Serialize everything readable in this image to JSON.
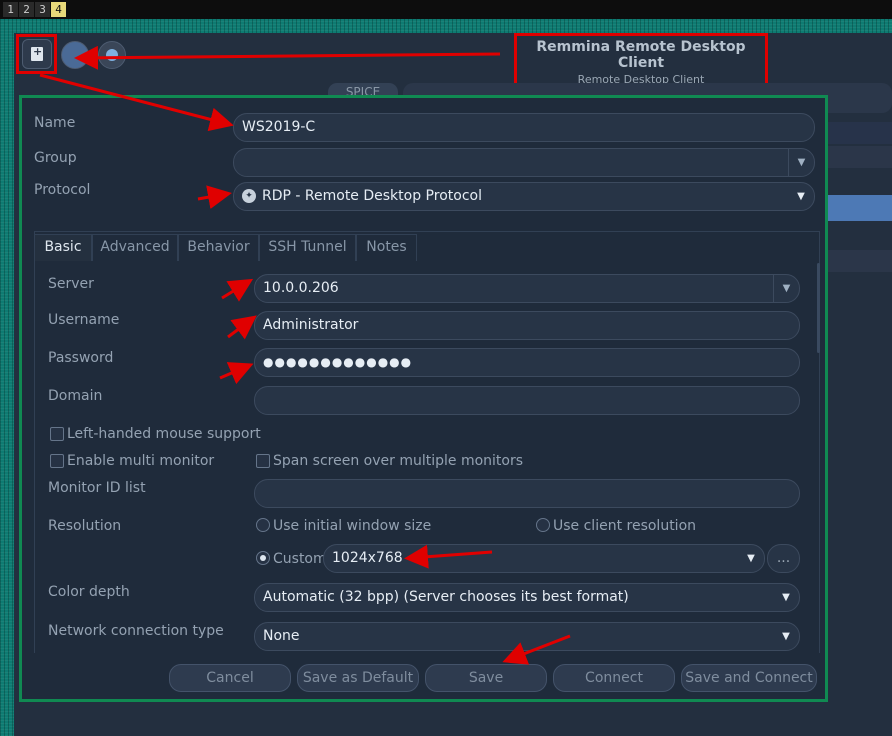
{
  "workspaces": [
    "1",
    "2",
    "3",
    "4"
  ],
  "active_workspace": "4",
  "window": {
    "title": "Remmina Remote Desktop Client",
    "subtitle": "Remote Desktop Client",
    "tab_label": "SPICE"
  },
  "toolbar": {
    "new_icon": "new-connection-icon",
    "connect_icon": "connect-icon",
    "dot_icon": "status-dot-icon"
  },
  "dialog": {
    "name_label": "Name",
    "name_value": "WS2019-C",
    "group_label": "Group",
    "group_value": "",
    "protocol_label": "Protocol",
    "protocol_value": "RDP - Remote Desktop Protocol",
    "tabs": [
      "Basic",
      "Advanced",
      "Behavior",
      "SSH Tunnel",
      "Notes"
    ],
    "server_label": "Server",
    "server_value": "10.0.0.206",
    "username_label": "Username",
    "username_value": "Administrator",
    "password_label": "Password",
    "password_value": "●●●●●●●●●●●●●",
    "domain_label": "Domain",
    "domain_value": "",
    "left_handed_label": "Left-handed mouse support",
    "multi_monitor_label": "Enable multi monitor",
    "span_screen_label": "Span screen over multiple monitors",
    "monitor_id_label": "Monitor ID list",
    "resolution_label": "Resolution",
    "use_initial_label": "Use initial window size",
    "use_client_label": "Use client resolution",
    "custom_label": "Custom",
    "custom_resolution_value": "1024x768",
    "more_button": "...",
    "color_depth_label": "Color depth",
    "color_depth_value": "Automatic (32 bpp) (Server chooses its best format)",
    "network_type_label": "Network connection type",
    "network_type_value": "None",
    "buttons": {
      "cancel": "Cancel",
      "save_default": "Save as Default",
      "save": "Save",
      "connect": "Connect",
      "save_connect": "Save and Connect"
    }
  },
  "colors": {
    "annotation": "#e00000",
    "dialog_border": "#108a52",
    "desktop": "#0e7b72"
  }
}
